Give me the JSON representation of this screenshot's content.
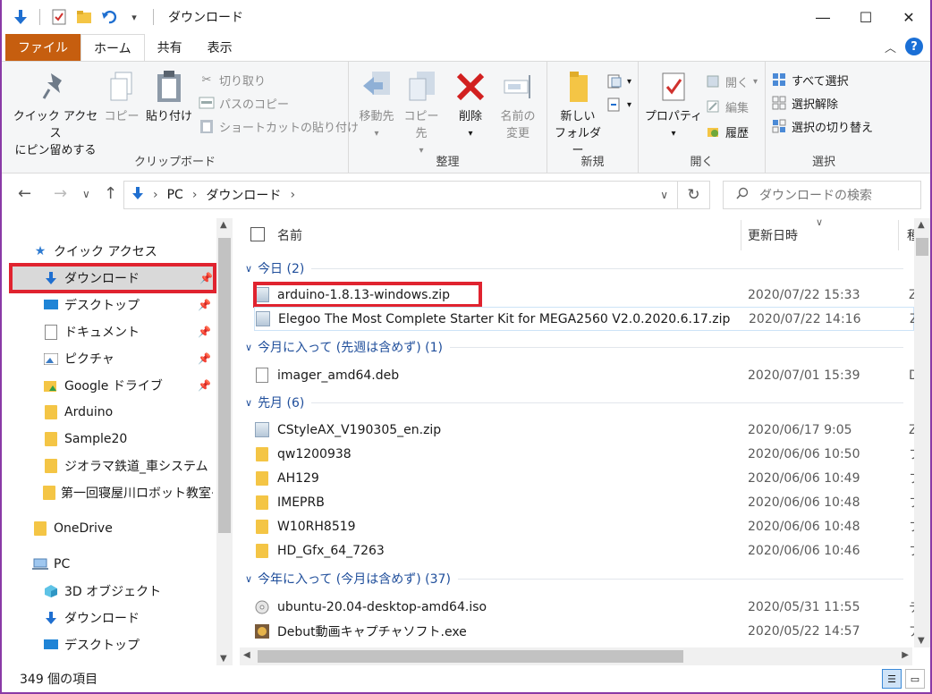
{
  "title_bar": {
    "title": "ダウンロード",
    "icons": [
      "down-arrow-icon",
      "checklist-icon",
      "folder-icon",
      "undo-icon",
      "chevron-down-icon"
    ],
    "window_buttons": [
      "minimize",
      "maximize",
      "close"
    ]
  },
  "tabs": {
    "file": "ファイル",
    "home": "ホーム",
    "share": "共有",
    "view": "表示",
    "help": "?"
  },
  "ribbon": {
    "clipboard": {
      "label": "クリップボード",
      "pin": "クイック アクセス\nにピン留めする",
      "pin_line1": "クイック アクセス",
      "pin_line2": "にピン留めする",
      "copy": "コピー",
      "paste": "貼り付け",
      "cut": "切り取り",
      "copy_path": "パスのコピー",
      "paste_shortcut": "ショートカットの貼り付け"
    },
    "organize": {
      "label": "整理",
      "move_to": "移動先",
      "copy_to": "コピー先",
      "delete": "削除",
      "rename_line1": "名前の",
      "rename_line2": "変更"
    },
    "new": {
      "label": "新規",
      "new_folder_line1": "新しい",
      "new_folder_line2": "フォルダー"
    },
    "open": {
      "label": "開く",
      "properties": "プロパティ",
      "open": "開く",
      "edit": "編集",
      "history": "履歴"
    },
    "select": {
      "label": "選択",
      "select_all": "すべて選択",
      "select_none": "選択解除",
      "invert": "選択の切り替え"
    }
  },
  "address": {
    "segments": [
      "PC",
      "ダウンロード"
    ],
    "search_placeholder": "ダウンロードの検索"
  },
  "nav_pane": {
    "quick_access": "クイック アクセス",
    "items": [
      {
        "label": "ダウンロード",
        "icon": "download-icon",
        "pinned": true
      },
      {
        "label": "デスクトップ",
        "icon": "desktop-icon",
        "pinned": true
      },
      {
        "label": "ドキュメント",
        "icon": "document-icon",
        "pinned": true
      },
      {
        "label": "ピクチャ",
        "icon": "picture-icon",
        "pinned": true
      },
      {
        "label": "Google ドライブ",
        "icon": "google-drive-icon",
        "pinned": true
      },
      {
        "label": "Arduino",
        "icon": "folder-icon"
      },
      {
        "label": "Sample20",
        "icon": "folder-icon"
      },
      {
        "label": "ジオラマ鉄道_車システム",
        "icon": "folder-icon"
      },
      {
        "label": "第一回寝屋川ロボット教室※",
        "icon": "folder-icon"
      }
    ],
    "onedrive": "OneDrive",
    "pc": "PC",
    "pc_items": [
      {
        "label": "3D オブジェクト",
        "icon": "3d-objects-icon"
      },
      {
        "label": "ダウンロード",
        "icon": "download-icon"
      },
      {
        "label": "デスクトップ",
        "icon": "desktop-icon"
      }
    ]
  },
  "list": {
    "columns": {
      "name": "名前",
      "date": "更新日時",
      "type": "種"
    },
    "groups": [
      {
        "header": "今日 (2)",
        "rows": [
          {
            "name": "arduino-1.8.13-windows.zip",
            "date": "2020/07/22 15:33",
            "type": "Z",
            "icon": "zip-icon"
          },
          {
            "name": "Elegoo The Most Complete Starter Kit for MEGA2560 V2.0.2020.6.17.zip",
            "date": "2020/07/22 14:16",
            "type": "Z",
            "icon": "zip-icon"
          }
        ]
      },
      {
        "header": "今月に入って (先週は含めず) (1)",
        "rows": [
          {
            "name": "imager_amd64.deb",
            "date": "2020/07/01 15:39",
            "type": "D",
            "icon": "file-icon"
          }
        ]
      },
      {
        "header": "先月 (6)",
        "rows": [
          {
            "name": "CStyleAX_V190305_en.zip",
            "date": "2020/06/17 9:05",
            "type": "Z",
            "icon": "zip-icon"
          },
          {
            "name": "qw1200938",
            "date": "2020/06/06 10:50",
            "type": "フ",
            "icon": "folder-icon"
          },
          {
            "name": "AH129",
            "date": "2020/06/06 10:49",
            "type": "フ",
            "icon": "folder-icon"
          },
          {
            "name": "IMEPRB",
            "date": "2020/06/06 10:48",
            "type": "フ",
            "icon": "folder-icon"
          },
          {
            "name": "W10RH8519",
            "date": "2020/06/06 10:48",
            "type": "フ",
            "icon": "folder-icon"
          },
          {
            "name": "HD_Gfx_64_7263",
            "date": "2020/06/06 10:46",
            "type": "フ",
            "icon": "folder-icon"
          }
        ]
      },
      {
        "header": "今年に入って (今月は含めず) (37)",
        "rows": [
          {
            "name": "ubuntu-20.04-desktop-amd64.iso",
            "date": "2020/05/31 11:55",
            "type": "デ",
            "icon": "disc-image-icon"
          },
          {
            "name": "Debut動画キャプチャソフト.exe",
            "date": "2020/05/22 14:57",
            "type": "ア",
            "icon": "app-icon"
          }
        ]
      }
    ]
  },
  "status": {
    "count": "349 個の項目"
  },
  "colors": {
    "file_tab": "#c65e0f",
    "highlight_red": "#e0232f",
    "window_border": "#8a3aa6",
    "group_header": "#1f4e9b"
  }
}
